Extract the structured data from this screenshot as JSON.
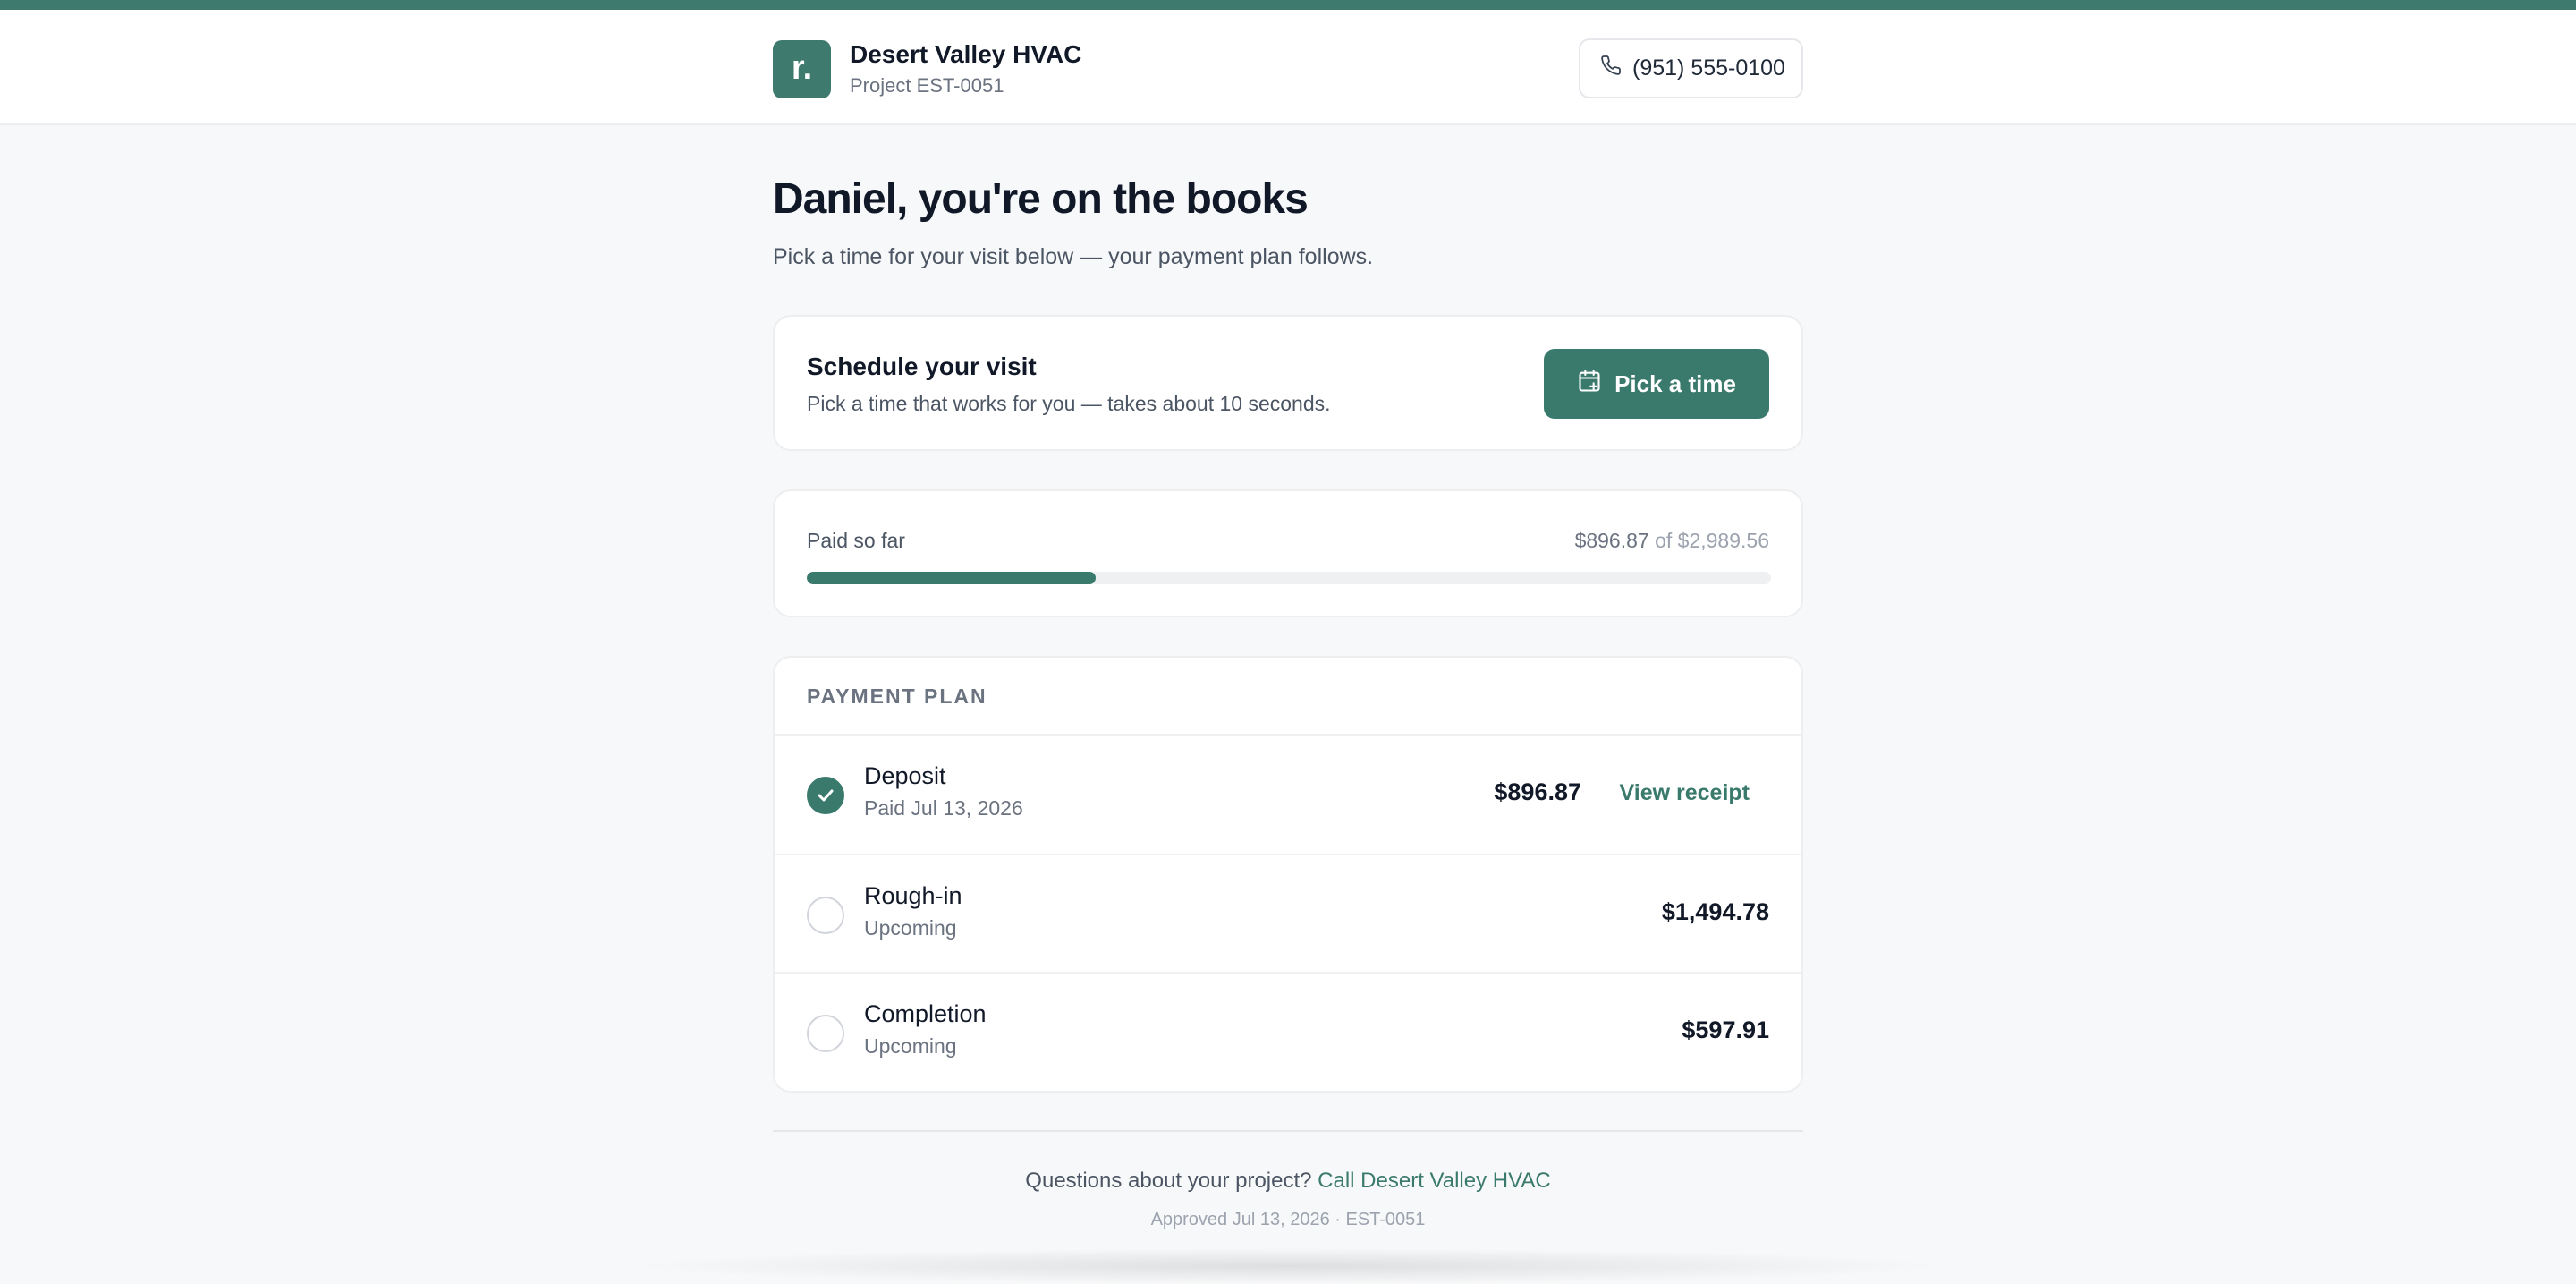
{
  "colors": {
    "brand": "#3a7a6c",
    "background": "#f7f8f9",
    "card": "#ffffff",
    "muted_text": "#6b7280"
  },
  "header": {
    "logo_letter": "r.",
    "company_name": "Desert Valley HVAC",
    "project_label": "Project EST-0051",
    "phone": "(951) 555-0100",
    "phone_icon": "phone-icon"
  },
  "intro": {
    "title": "Daniel, you're on the books",
    "subtitle": "Pick a time for your visit below — your payment plan follows."
  },
  "schedule": {
    "title": "Schedule your visit",
    "description": "Pick a time that works for you — takes about 10 seconds.",
    "button_label": "Pick a time",
    "button_icon": "calendar-plus-icon"
  },
  "paid": {
    "label": "Paid so far",
    "paid_amount": "$896.87",
    "of_text": " of ",
    "total_amount": "$2,989.56",
    "progress_fraction": 0.3
  },
  "plan": {
    "header": "PAYMENT PLAN",
    "rows": [
      {
        "title": "Deposit",
        "status": "Paid Jul 13, 2026",
        "amount": "$896.87",
        "done": true,
        "action": "View receipt"
      },
      {
        "title": "Rough-in",
        "status": "Upcoming",
        "amount": "$1,494.78",
        "done": false
      },
      {
        "title": "Completion",
        "status": "Upcoming",
        "amount": "$597.91",
        "done": false
      }
    ]
  },
  "footer": {
    "question": "Questions about your project? ",
    "call_link": "Call Desert Valley HVAC",
    "approved": "Approved Jul 13, 2026 · EST-0051"
  }
}
